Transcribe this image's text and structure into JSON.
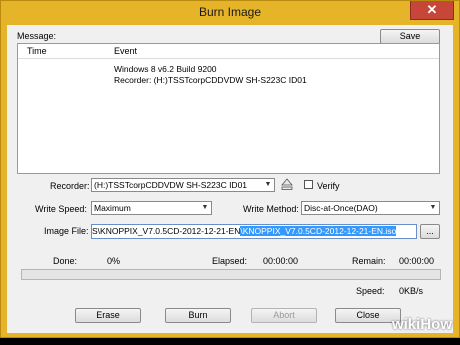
{
  "window": {
    "title": "Burn Image",
    "close_glyph": "✕"
  },
  "message": {
    "label": "Message:",
    "save_label": "Save",
    "columns": [
      "Time",
      "Event"
    ],
    "lines": [
      "Windows 8 v6.2 Build 9200",
      "Recorder: (H:)TSSTcorpCDDVDW SH-S223C ID01"
    ]
  },
  "recorder": {
    "label": "Recorder:",
    "value": "(H:)TSSTcorpCDDVDW SH-S223C ID01",
    "eject_icon": "eject-icon",
    "verify_label": "Verify",
    "verify_checked": false
  },
  "write_speed": {
    "label": "Write Speed:",
    "value": "Maximum"
  },
  "write_method": {
    "label": "Write Method:",
    "value": "Disc-at-Once(DAO)"
  },
  "image_file": {
    "label": "Image File:",
    "value_plain": "S\\KNOPPIX_V7.0.5CD-2012-12-21-EN",
    "value_selected": "\\KNOPPIX_V7.0.5CD-2012-12-21-EN.iso",
    "browse_label": "..."
  },
  "status": {
    "done_label": "Done:",
    "done_value": "0%",
    "elapsed_label": "Elapsed:",
    "elapsed_value": "00:00:00",
    "remain_label": "Remain:",
    "remain_value": "00:00:00",
    "progress": 0.0,
    "speed_label": "Speed:",
    "speed_value": "0KB/s"
  },
  "buttons": {
    "erase": "Erase",
    "burn": "Burn",
    "abort": "Abort",
    "close": "Close"
  },
  "watermark": {
    "wiki": "wiki",
    "how": "How"
  },
  "colors": {
    "frame": "#e6b429",
    "close": "#c7463a",
    "selection": "#3399ff",
    "progress": "#06b025"
  }
}
